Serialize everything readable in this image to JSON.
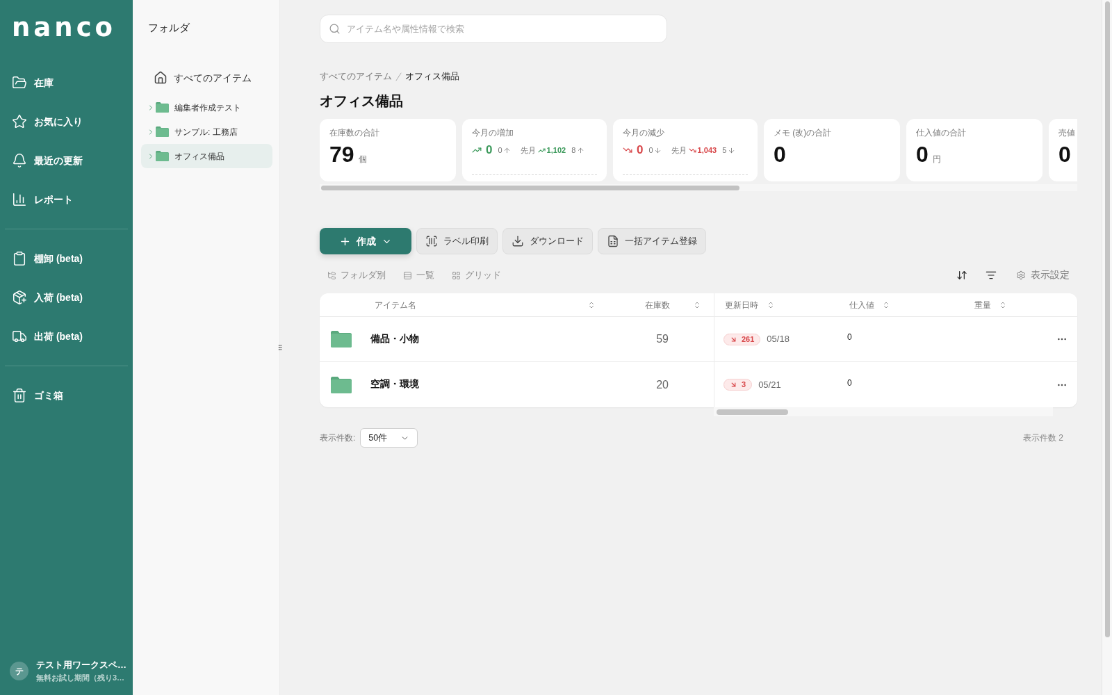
{
  "sidebar": {
    "logo": "nanco",
    "sections": [
      {
        "items": [
          "在庫",
          "お気に入り",
          "最近の更新",
          "レポート"
        ]
      },
      {
        "items": [
          "棚卸 (beta)",
          "入荷 (beta)",
          "出荷 (beta)"
        ]
      },
      {
        "items": [
          "ゴミ箱"
        ]
      }
    ],
    "workspace": {
      "avatar": "テ",
      "name": "テスト用ワークスペ…",
      "plan": "無料お試し期間（残り3…"
    }
  },
  "folder_panel": {
    "title": "フォルダ",
    "root": "すべてのアイテム",
    "folders": [
      {
        "label": "編集者作成テスト",
        "expanded": false,
        "selected": false
      },
      {
        "label": "サンプル: 工務店",
        "expanded": false,
        "selected": false
      },
      {
        "label": "オフィス備品",
        "expanded": false,
        "selected": true
      }
    ]
  },
  "search": {
    "placeholder": "アイテム名や属性情報で検索"
  },
  "breadcrumb": [
    "すべてのアイテム",
    "オフィス備品"
  ],
  "title": "オフィス備品",
  "stat_cards": [
    {
      "kind": "total",
      "label": "在庫数の合計",
      "value": "79",
      "unit": "個"
    },
    {
      "kind": "increase",
      "label": "今月の増加",
      "value": "0",
      "count": "0",
      "previous_label": "先月",
      "previous_value": "1,102",
      "previous_count": "8"
    },
    {
      "kind": "decrease",
      "label": "今月の減少",
      "value": "0",
      "count": "0",
      "previous_label": "先月",
      "previous_value": "1,043",
      "previous_count": "5"
    },
    {
      "kind": "total",
      "label": "メモ (改)の合計",
      "value": "0"
    },
    {
      "kind": "total",
      "label": "仕入値の合計",
      "value": "0",
      "unit": "円"
    },
    {
      "kind": "total",
      "label": "売値",
      "value": "0"
    }
  ],
  "actions": [
    {
      "kind": "primary",
      "label": "作成"
    },
    {
      "kind": "secondary",
      "label": "ラベル印刷"
    },
    {
      "kind": "secondary",
      "label": "ダウンロード"
    },
    {
      "kind": "secondary",
      "label": "一括アイテム登録"
    }
  ],
  "view_tabs": [
    {
      "label": "フォルダ別",
      "selected": false
    },
    {
      "label": "一覧",
      "selected": false
    },
    {
      "label": "グリッド",
      "selected": false
    }
  ],
  "display_settings": "表示設定",
  "table": {
    "columns": [
      "アイテム名",
      "在庫数",
      "更新日時",
      "仕入値",
      "重量"
    ],
    "rows": [
      {
        "name": "備品・小物",
        "stock": "59",
        "change": {
          "kind": "decrease",
          "value": "261"
        },
        "updated": "05/18",
        "cost": "0"
      },
      {
        "name": "空調・環境",
        "stock": "20",
        "change": {
          "kind": "decrease",
          "value": "3"
        },
        "updated": "05/21",
        "cost": "0"
      }
    ]
  },
  "footer": {
    "page_size_label": "表示件数:",
    "page_size": "50件",
    "count": "表示件数 2"
  }
}
